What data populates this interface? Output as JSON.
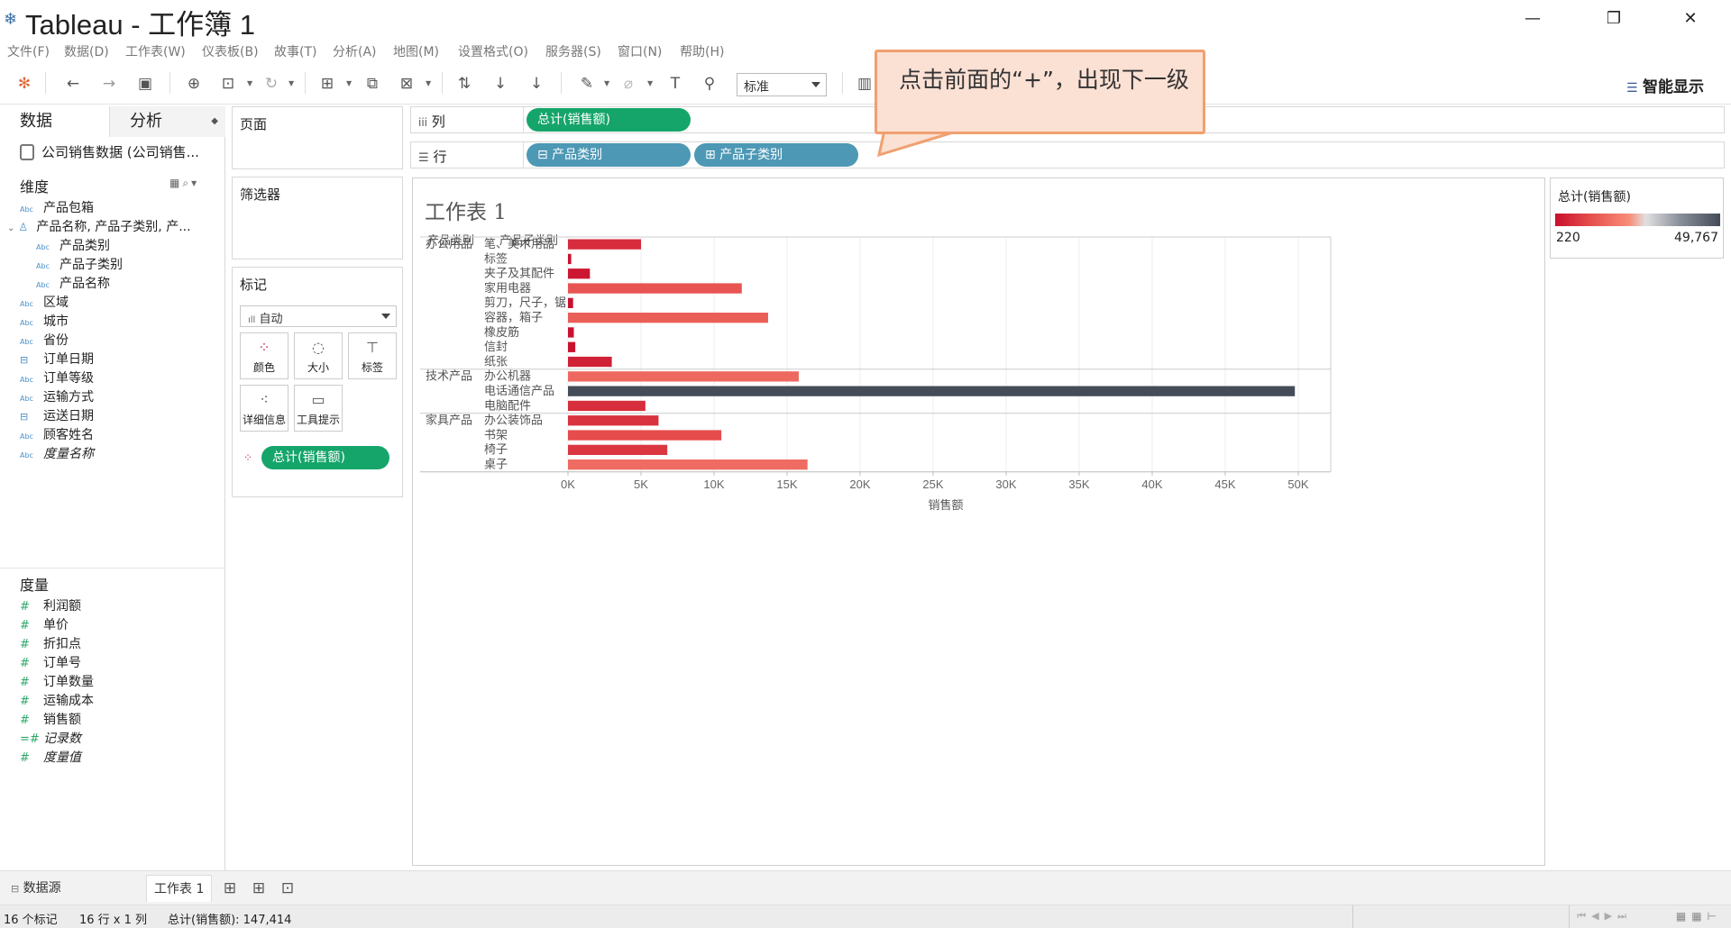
{
  "window": {
    "title": "Tableau - 工作簿 1"
  },
  "menu": [
    "文件(F)",
    "数据(D)",
    "工作表(W)",
    "仪表板(B)",
    "故事(T)",
    "分析(A)",
    "地图(M)",
    "设置格式(O)",
    "服务器(S)",
    "窗口(N)",
    "帮助(H)"
  ],
  "toolbar": {
    "fit_value": "标准",
    "show_me_label": "智能显示"
  },
  "left_pane": {
    "tab_data": "数据",
    "tab_analysis": "分析",
    "datasource": "公司销售数据 (公司销售...",
    "dimensions_title": "维度",
    "dimensions": [
      {
        "type": "Abc",
        "label": "产品包箱"
      },
      {
        "type": "hier",
        "label": "产品名称, 产品子类别, 产..."
      },
      {
        "type": "Abc",
        "label": "产品类别"
      },
      {
        "type": "Abc",
        "label": "产品子类别"
      },
      {
        "type": "Abc",
        "label": "产品名称"
      },
      {
        "type": "Abc",
        "label": "区域"
      },
      {
        "type": "Abc",
        "label": "城市"
      },
      {
        "type": "Abc",
        "label": "省份"
      },
      {
        "type": "date",
        "label": "订单日期"
      },
      {
        "type": "Abc",
        "label": "订单等级"
      },
      {
        "type": "Abc",
        "label": "运输方式"
      },
      {
        "type": "date",
        "label": "运送日期"
      },
      {
        "type": "Abc",
        "label": "顾客姓名"
      },
      {
        "type": "Abc",
        "label": "度量名称"
      }
    ],
    "measures_title": "度量",
    "measures": [
      "利润额",
      "单价",
      "折扣点",
      "订单号",
      "订单数量",
      "运输成本",
      "销售额",
      "记录数",
      "度量值"
    ]
  },
  "shelves": {
    "pages_title": "页面",
    "filters_title": "筛选器",
    "marks_title": "标记",
    "marks_type": "自动",
    "mark_buttons": [
      "颜色",
      "大小",
      "标签",
      "详细信息",
      "工具提示"
    ],
    "marks_pill": "总计(销售额)",
    "columns_label": "列",
    "rows_label": "行",
    "columns_pill": "总计(销售额)",
    "rows_pills": [
      "⊟ 产品类别",
      "⊞ 产品子类别"
    ]
  },
  "callout": {
    "text": "点击前面的“+”，出现下一级"
  },
  "sheet": {
    "title": "工作表 1",
    "header_category": "产品类别",
    "header_subcategory": "产品子类别",
    "x_axis_label": "销售额"
  },
  "legend": {
    "title": "总计(销售额)",
    "min": "220",
    "max": "49,767"
  },
  "chart_data": {
    "type": "bar",
    "orientation": "horizontal",
    "xlabel": "销售额",
    "xlim": [
      0,
      50000
    ],
    "x_ticks": [
      "0K",
      "5K",
      "10K",
      "15K",
      "20K",
      "25K",
      "30K",
      "35K",
      "40K",
      "45K",
      "50K"
    ],
    "grid": true,
    "groups": [
      {
        "category": "办公用品",
        "rows": [
          {
            "subcategory": "笔、美术用品",
            "value": 5000
          },
          {
            "subcategory": "标签",
            "value": 220
          },
          {
            "subcategory": "夹子及其配件",
            "value": 1500
          },
          {
            "subcategory": "家用电器",
            "value": 11900
          },
          {
            "subcategory": "剪刀，尺子，锯",
            "value": 350
          },
          {
            "subcategory": "容器，箱子",
            "value": 13700
          },
          {
            "subcategory": "橡皮筋",
            "value": 400
          },
          {
            "subcategory": "信封",
            "value": 500
          },
          {
            "subcategory": "纸张",
            "value": 3000
          }
        ]
      },
      {
        "category": "技术产品",
        "rows": [
          {
            "subcategory": "办公机器",
            "value": 15800
          },
          {
            "subcategory": "电话通信产品",
            "value": 49767
          },
          {
            "subcategory": "电脑配件",
            "value": 5300
          }
        ]
      },
      {
        "category": "家具产品",
        "rows": [
          {
            "subcategory": "办公装饰品",
            "value": 6200
          },
          {
            "subcategory": "书架",
            "value": 10500
          },
          {
            "subcategory": "椅子",
            "value": 6800
          },
          {
            "subcategory": "桌子",
            "value": 16400
          }
        ]
      }
    ],
    "color_min": 220,
    "color_max": 49767
  },
  "sheet_tabs": {
    "datasource": "数据源",
    "sheet1": "工作表 1"
  },
  "status": {
    "marks": "16 个标记",
    "dims": "16 行 x 1 列",
    "sum": "总计(销售额): 147,414"
  }
}
